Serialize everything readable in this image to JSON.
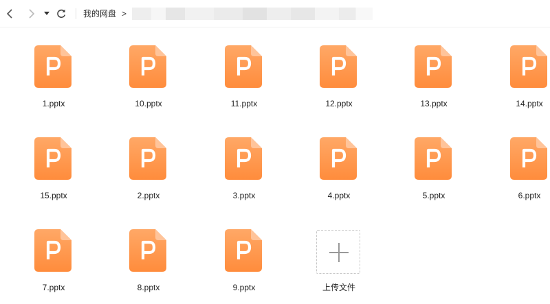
{
  "toolbar": {
    "back_icon": "chevron-left-icon",
    "forward_icon": "chevron-right-icon",
    "dropdown_icon": "caret-down-icon",
    "refresh_icon": "refresh-icon",
    "breadcrumb_root": "我的网盘",
    "breadcrumb_separator": ">"
  },
  "files": [
    {
      "name": "1.pptx"
    },
    {
      "name": "10.pptx"
    },
    {
      "name": "11.pptx"
    },
    {
      "name": "12.pptx"
    },
    {
      "name": "13.pptx"
    },
    {
      "name": "14.pptx"
    },
    {
      "name": "15.pptx"
    },
    {
      "name": "2.pptx"
    },
    {
      "name": "3.pptx"
    },
    {
      "name": "4.pptx"
    },
    {
      "name": "5.pptx"
    },
    {
      "name": "6.pptx"
    },
    {
      "name": "7.pptx"
    },
    {
      "name": "8.pptx"
    },
    {
      "name": "9.pptx"
    }
  ],
  "file_icon": "pptx-file-icon",
  "upload": {
    "label": "上传文件",
    "icon": "plus-icon"
  },
  "colors": {
    "icon_orange_top": "#ffa866",
    "icon_orange_bottom": "#ff8c3c",
    "icon_fold": "#ffc49a"
  }
}
